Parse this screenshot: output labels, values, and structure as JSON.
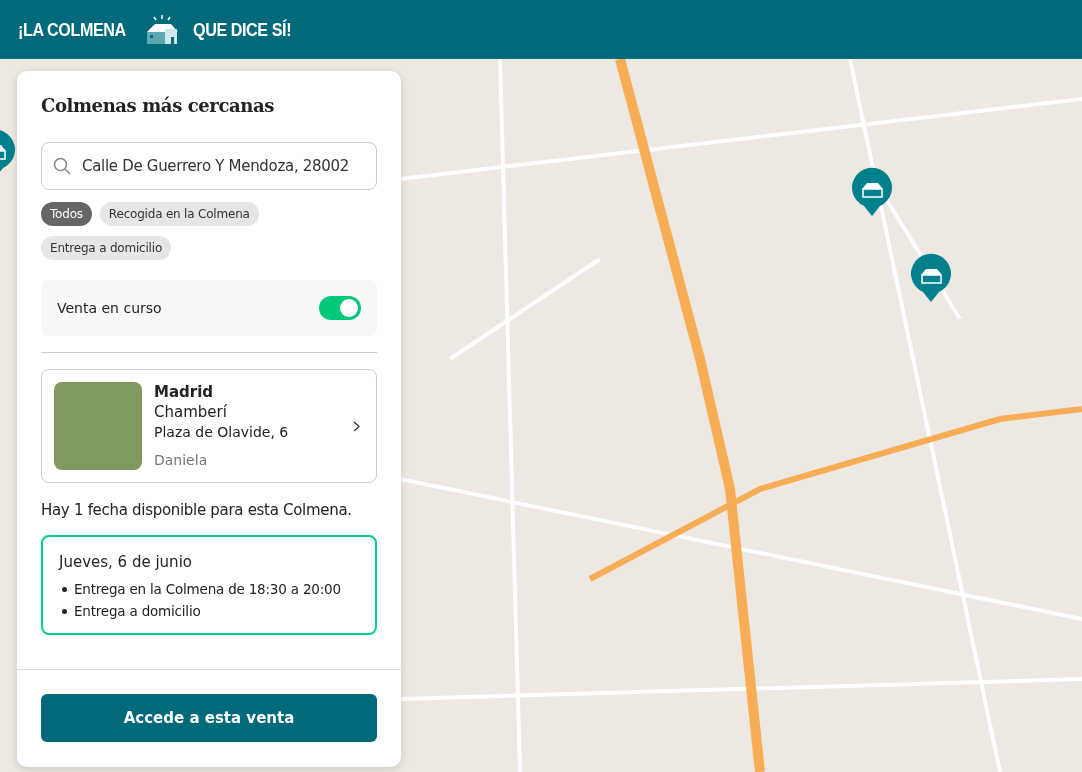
{
  "header": {
    "logo_left": "¡LA COLMENA",
    "logo_right": "QUE DICE SÍ!"
  },
  "panel": {
    "title": "Colmenas más cercanas",
    "search": {
      "value": "Calle De Guerrero Y Mendoza, 28002"
    },
    "filters": [
      {
        "label": "Todos",
        "selected": true
      },
      {
        "label": "Recogida en la Colmena",
        "selected": false
      },
      {
        "label": "Entrega a domicilio",
        "selected": false
      }
    ],
    "toggle": {
      "label": "Venta en curso",
      "on": true
    },
    "hive": {
      "city": "Madrid",
      "district": "Chamberí",
      "address": "Plaza de Olavide, 6",
      "host": "Daniela"
    },
    "availability": "Hay 1 fecha disponible para esta Colmena.",
    "date": {
      "title": "Jueves, 6 de junio",
      "items": [
        "Entrega en la Colmena de 18:30 a 20:00",
        "Entrega a domicilio"
      ]
    },
    "button": "Accede a esta venta"
  }
}
